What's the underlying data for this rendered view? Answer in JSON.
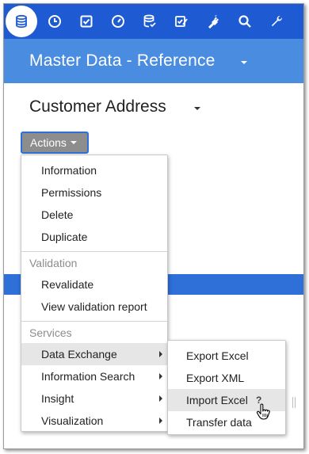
{
  "topbar": {
    "icons": [
      {
        "name": "database-icon",
        "active": true
      },
      {
        "name": "clock-icon"
      },
      {
        "name": "checkbox-icon"
      },
      {
        "name": "gauge-icon"
      },
      {
        "name": "database-check-icon"
      },
      {
        "name": "edit-check-icon"
      },
      {
        "name": "plug-icon"
      },
      {
        "name": "search-icon"
      },
      {
        "name": "wrench-icon"
      }
    ]
  },
  "header": {
    "title": "Master Data - Reference"
  },
  "page": {
    "subtitle": "Customer Address"
  },
  "actions_button": {
    "label": "Actions"
  },
  "menu": {
    "items_top": [
      "Information",
      "Permissions",
      "Delete",
      "Duplicate"
    ],
    "section_validation": "Validation",
    "items_validation": [
      "Revalidate",
      "View validation report"
    ],
    "section_services": "Services",
    "items_services": [
      "Data Exchange",
      "Information Search",
      "Insight",
      "Visualization"
    ]
  },
  "submenu": {
    "items": [
      "Export Excel",
      "Export XML",
      "Import Excel",
      "Transfer data"
    ],
    "help_marker": "?"
  },
  "colors": {
    "topbar": "#1e5bd3",
    "header": "#4a8de0",
    "accent": "#2e6fd8",
    "button": "#8d8d8d"
  }
}
